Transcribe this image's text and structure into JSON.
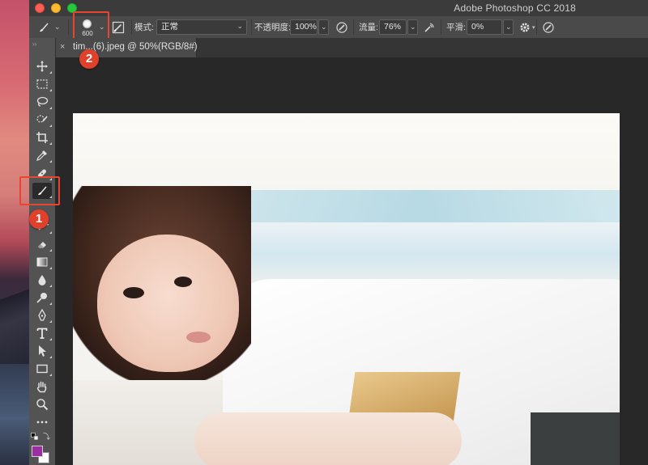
{
  "window": {
    "app_title": "Adobe Photoshop CC 2018"
  },
  "options_bar": {
    "brush_size": "600",
    "mode_label": "模式:",
    "mode_value": "正常",
    "opacity_label": "不透明度:",
    "opacity_value": "100%",
    "flow_label": "流量:",
    "flow_value": "76%",
    "smoothing_label": "平滑:",
    "smoothing_value": "0%"
  },
  "document_tab": {
    "title": "tim...(6).jpeg @ 50%(RGB/8#)",
    "close_glyph": "×"
  },
  "annotations": [
    {
      "number": "1",
      "target": "brush-tool"
    },
    {
      "number": "2",
      "target": "brush-preset-picker"
    }
  ],
  "colors": {
    "highlight": "#e8442f",
    "badge": "#e1402b",
    "foreground_swatch": "#9b2fa0",
    "background_swatch": "#ffffff"
  },
  "tools": [
    {
      "name": "move-tool",
      "icon": "move-icon"
    },
    {
      "name": "marquee-tool",
      "icon": "marquee-icon"
    },
    {
      "name": "lasso-tool",
      "icon": "lasso-icon"
    },
    {
      "name": "quick-selection-tool",
      "icon": "quick-selection-icon"
    },
    {
      "name": "crop-tool",
      "icon": "crop-icon"
    },
    {
      "name": "eyedropper-tool",
      "icon": "eyedropper-icon"
    },
    {
      "name": "healing-tool",
      "icon": "bandage-icon"
    },
    {
      "name": "brush-tool",
      "icon": "brush-icon",
      "active": true
    },
    {
      "name": "clone-stamp-tool",
      "icon": "stamp-icon"
    },
    {
      "name": "history-brush-tool",
      "icon": "history-brush-icon"
    },
    {
      "name": "eraser-tool",
      "icon": "eraser-icon"
    },
    {
      "name": "gradient-tool",
      "icon": "gradient-icon"
    },
    {
      "name": "blur-tool",
      "icon": "drop-icon"
    },
    {
      "name": "dodge-tool",
      "icon": "dodge-icon"
    },
    {
      "name": "pen-tool",
      "icon": "pen-icon"
    },
    {
      "name": "type-tool",
      "icon": "type-icon"
    },
    {
      "name": "path-selection-tool",
      "icon": "arrow-icon"
    },
    {
      "name": "rectangle-tool",
      "icon": "rectangle-icon"
    },
    {
      "name": "hand-tool",
      "icon": "hand-icon"
    },
    {
      "name": "zoom-tool",
      "icon": "zoom-icon"
    },
    {
      "name": "more-tools",
      "icon": "ellipsis-icon"
    }
  ]
}
